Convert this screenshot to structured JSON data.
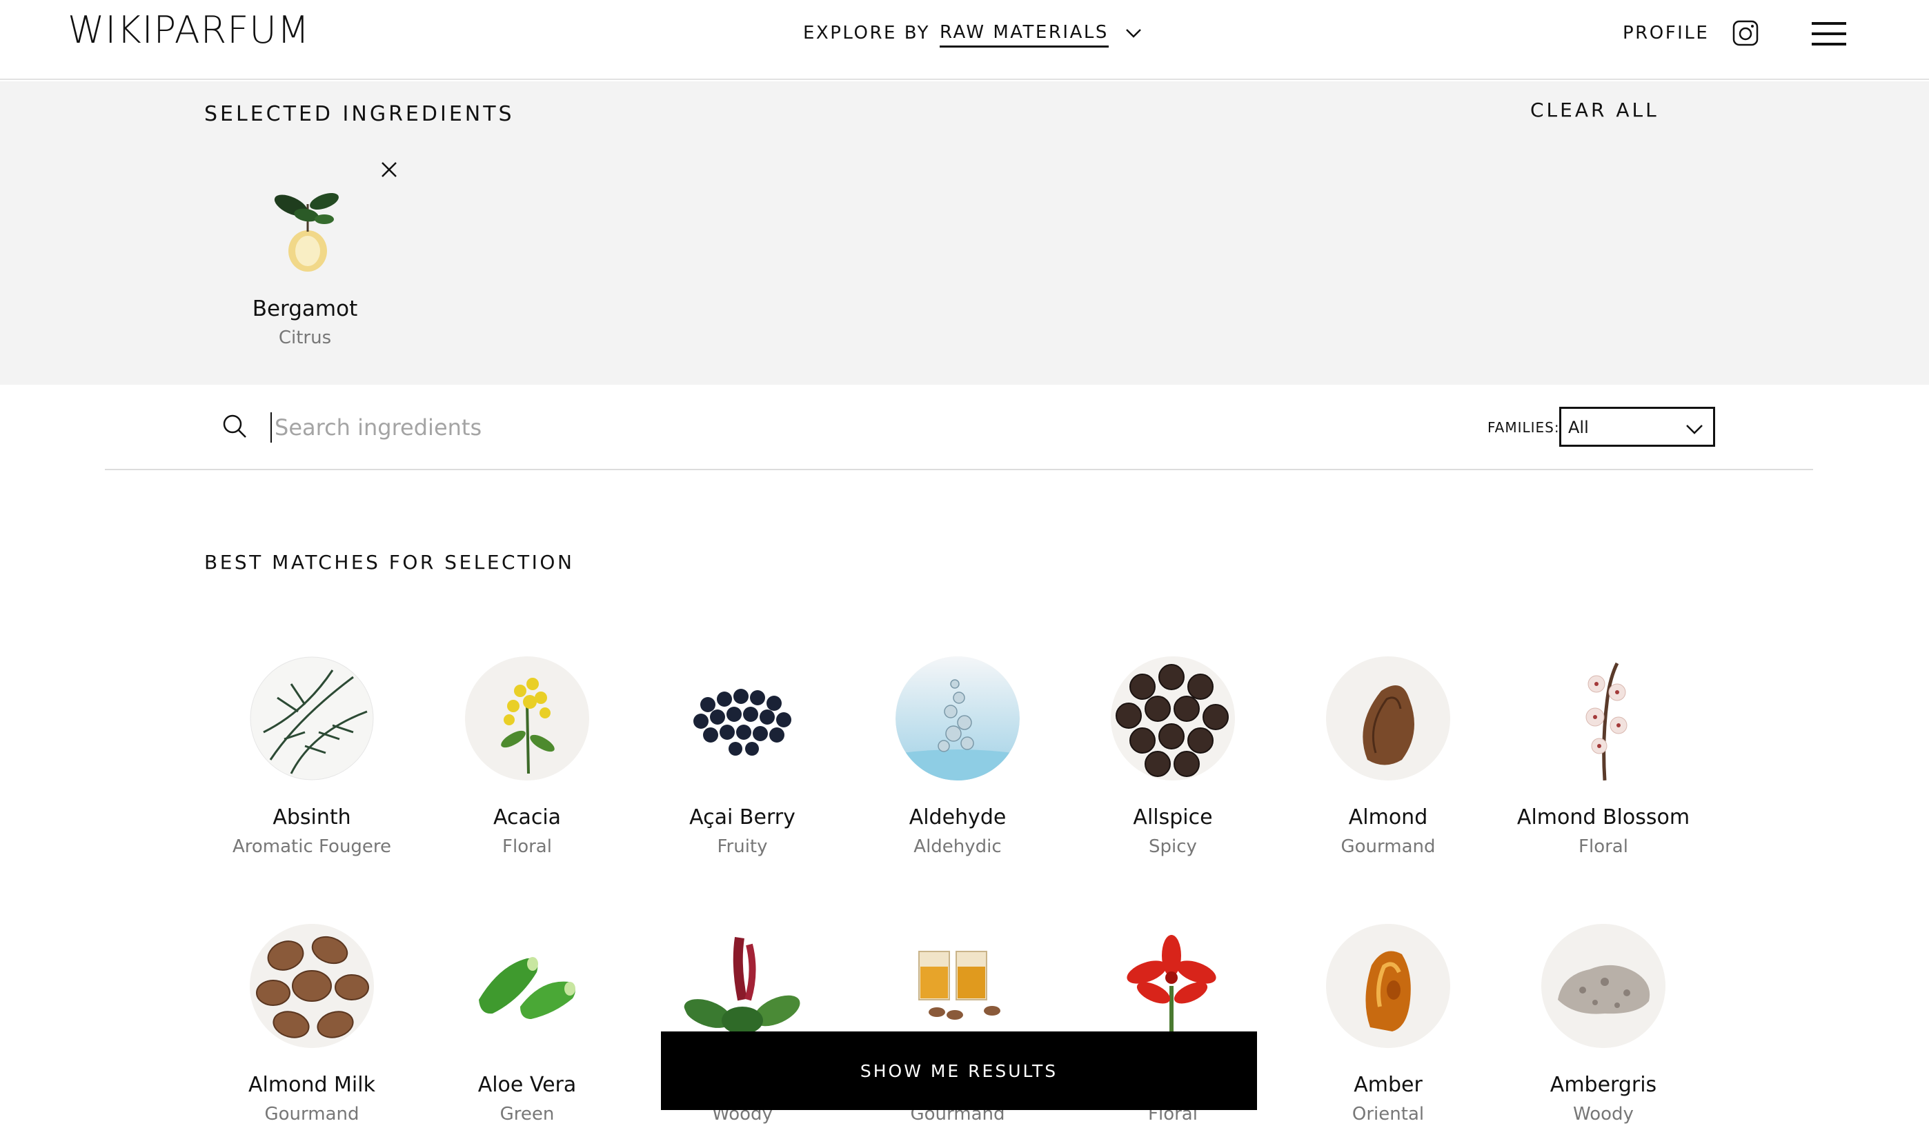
{
  "header": {
    "logo": "WIKIPARFUM",
    "explore_by": "EXPLORE BY",
    "explore_value": "RAW MATERIALS",
    "profile": "PROFILE"
  },
  "selected": {
    "title": "SELECTED INGREDIENTS",
    "clear_all": "CLEAR ALL",
    "items": [
      {
        "name": "Bergamot",
        "family": "Citrus"
      }
    ]
  },
  "search": {
    "placeholder": "Search ingredients",
    "value": "",
    "families_label": "FAMILIES:",
    "families_value": "All"
  },
  "matches": {
    "title": "BEST MATCHES FOR SELECTION",
    "items": [
      {
        "name": "Absinth",
        "family": "Aromatic Fougere",
        "icon": "absinth-leaves-image"
      },
      {
        "name": "Acacia",
        "family": "Floral",
        "icon": "acacia-flower-image"
      },
      {
        "name": "Açai Berry",
        "family": "Fruity",
        "icon": "acai-berries-image"
      },
      {
        "name": "Aldehyde",
        "family": "Aldehydic",
        "icon": "aldehyde-water-image"
      },
      {
        "name": "Allspice",
        "family": "Spicy",
        "icon": "allspice-seeds-image"
      },
      {
        "name": "Almond",
        "family": "Gourmand",
        "icon": "almond-nut-image"
      },
      {
        "name": "Almond Blossom",
        "family": "Floral",
        "icon": "almond-blossom-image"
      },
      {
        "name": "Almond Milk",
        "family": "Gourmand",
        "icon": "almond-milk-nuts-image"
      },
      {
        "name": "Aloe Vera",
        "family": "Green",
        "icon": "aloe-vera-image"
      },
      {
        "name": "",
        "family": "Woody",
        "icon": "amaranth-plant-image"
      },
      {
        "name": "",
        "family": "Gourmand",
        "icon": "amaretto-glasses-image"
      },
      {
        "name": "",
        "family": "Floral",
        "icon": "amaryllis-flower-image"
      },
      {
        "name": "Amber",
        "family": "Oriental",
        "icon": "amber-stone-image"
      },
      {
        "name": "Ambergris",
        "family": "Woody",
        "icon": "ambergris-rock-image"
      }
    ]
  },
  "results_button": "SHOW ME RESULTS",
  "colors": {
    "panel_bg": "#f3f3f3",
    "text": "#111111",
    "muted": "#777777",
    "button_bg": "#000000"
  }
}
